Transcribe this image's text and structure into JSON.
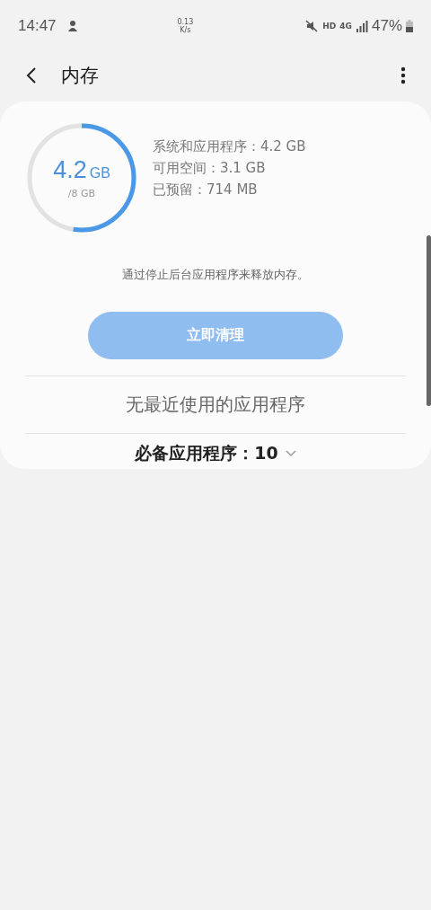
{
  "status_bar": {
    "time": "14:47",
    "net_speed": "0.13",
    "net_unit": "K/s",
    "hd": "HD",
    "network": "4G",
    "battery": "47%"
  },
  "app_bar": {
    "title": "内存"
  },
  "memory": {
    "used": "4.2",
    "used_unit": "GB",
    "total": "/8 GB",
    "level": 0.525,
    "details": [
      "系统和应用程序：4.2 GB",
      "可用空间：3.1 GB",
      "已预留：714 MB"
    ]
  },
  "hint": "通过停止后台应用程序来释放内存。",
  "clean_button": {
    "label": "立即清理",
    "disabled": true
  },
  "recent_apps": "无最近使用的应用程序",
  "essential_apps": {
    "label": "必备应用程序：10",
    "expanded": false
  }
}
